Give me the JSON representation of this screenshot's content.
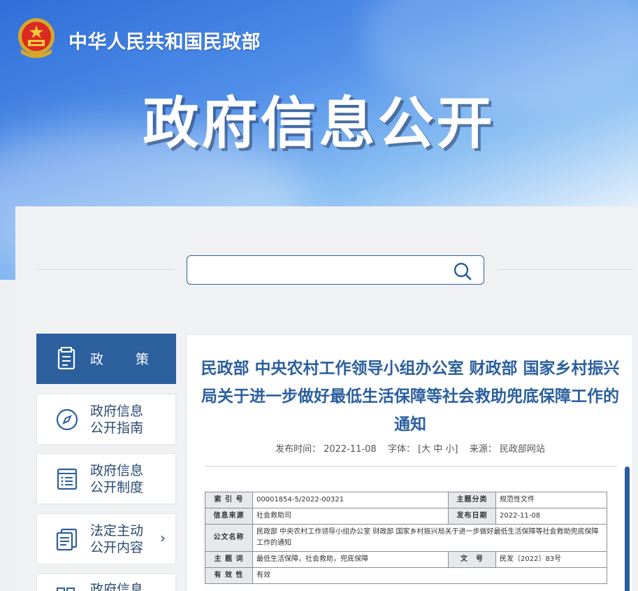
{
  "header": {
    "site_name": "中华人民共和国民政部",
    "banner_title": "政府信息公开"
  },
  "search": {
    "value": "",
    "placeholder": ""
  },
  "sidebar": {
    "items": [
      {
        "label": "政 策",
        "icon": "document-icon",
        "active": true
      },
      {
        "label_line1": "政府信息",
        "label_line2": "公开指南",
        "icon": "compass-icon"
      },
      {
        "label_line1": "政府信息",
        "label_line2": "公开制度",
        "icon": "list-icon"
      },
      {
        "label_line1": "法定主动",
        "label_line2": "公开内容",
        "icon": "files-icon",
        "has_arrow": true,
        "arrow": "›"
      },
      {
        "label_line1": "政府信息",
        "icon": "grid-icon"
      }
    ]
  },
  "article": {
    "title": "民政部 中央农村工作领导小组办公室 财政部 国家乡村振兴局关于进一步做好最低生活保障等社会救助兜底保障工作的通知",
    "meta": {
      "publish_label": "发布时间：",
      "publish_time": "2022-11-08",
      "font_label": "字体：",
      "font_options": "[大 中 小]",
      "source_label": "来源：",
      "source": "民政部网站"
    },
    "info_table": {
      "index_no_label": "索 引 号",
      "index_no": "00001854-5/2022-00321",
      "category_label": "主题分类",
      "category": "规范性文件",
      "source_label": "信息来源",
      "source": "社会救助司",
      "date_label": "发布日期",
      "date": "2022-11-08",
      "doc_name_label": "公文名称",
      "doc_name": "民政部 中央农村工作领导小组办公室 财政部 国家乡村振兴局关于进一步做好最低生活保障等社会救助兜底保障工作的通知",
      "keywords_label": "主 题 词",
      "keywords": "最低生活保障，社会救助，兜底保障",
      "doc_no_label": "文　号",
      "doc_no": "民发〔2022〕83号",
      "validity_label": "有 效 性",
      "validity": "有效"
    }
  },
  "colors": {
    "primary": "#2b5f9e",
    "banner_top": "#2f6fd8",
    "panel": "#f0f1f2"
  }
}
